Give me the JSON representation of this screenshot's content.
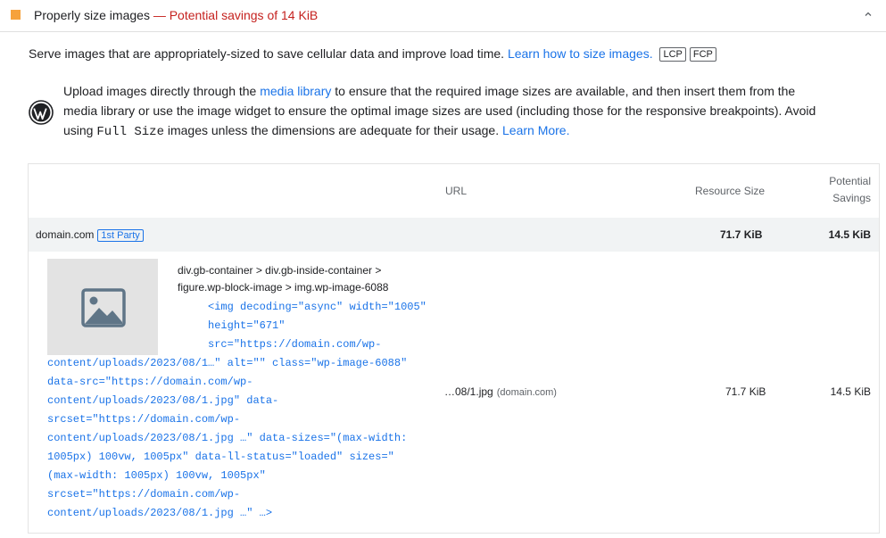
{
  "audit": {
    "title": "Properly size images",
    "separator": "—",
    "savings": "Potential savings of 14 KiB",
    "marker_color": "#f6a23c",
    "chevron_icon": "chevron-up-icon"
  },
  "description": {
    "text": "Serve images that are appropriately-sized to save cellular data and improve load time.",
    "link": "Learn how to size images.",
    "tags": [
      "LCP",
      "FCP"
    ]
  },
  "stack_pack": {
    "icon": "wordpress-icon",
    "text1": "Upload images directly through the",
    "link1": "media library",
    "text2": "to ensure that the required image sizes are available, and then insert them from the",
    "text3": "media library or use the image widget to ensure the optimal image sizes are used (including those for the responsive breakpoints). Avoid",
    "text4a": "using",
    "code": "Full Size",
    "text4b": "images unless the dimensions are adequate for their usage.",
    "link2": "Learn More."
  },
  "table": {
    "headers": {
      "url": "URL",
      "resource_size": "Resource Size",
      "savings_line1": "Potential",
      "savings_line2": "Savings"
    },
    "group": {
      "domain": "domain.com",
      "badge": "1st Party",
      "resource_size": "71.7 KiB",
      "savings": "14.5 KiB"
    },
    "row": {
      "thumbnail_icon": "image-placeholder-icon",
      "path_line1": "div.gb-container > div.gb-inside-container >",
      "path_line2": "figure.wp-block-image > img.wp-image-6088",
      "snippet": [
        "                         <img decoding=\"async\" width=\"1005\"",
        "                         height=\"671\"",
        "                         src=\"https://domain.com/wp-",
        "content/uploads/2023/08/1…\" alt=\"\" class=\"wp-image-6088\"",
        "data-src=\"https://domain.com/wp-",
        "content/uploads/2023/08/1.jpg\" data-",
        "srcset=\"https://domain.com/wp-",
        "content/uploads/2023/08/1.jpg …\" data-sizes=\"(max-width:",
        "1005px) 100vw, 1005px\" data-ll-status=\"loaded\" sizes=\"",
        "(max-width: 1005px) 100vw, 1005px\"",
        "srcset=\"https://domain.com/wp-",
        "content/uploads/2023/08/1.jpg …\" …>"
      ],
      "url": "…08/1.jpg",
      "url_host": "(domain.com)",
      "resource_size": "71.7 KiB",
      "savings": "14.5 KiB"
    }
  }
}
